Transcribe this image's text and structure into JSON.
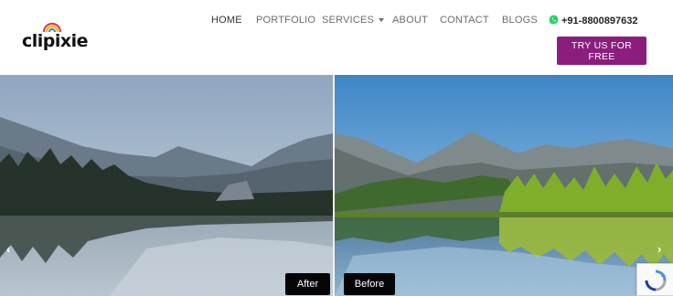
{
  "brand": {
    "logo_text": "clipixie"
  },
  "nav": {
    "items": [
      {
        "label": "HOME",
        "active": true
      },
      {
        "label": "PORTFOLIO"
      },
      {
        "label": "SERVICES",
        "has_dropdown": true
      },
      {
        "label": "ABOUT"
      },
      {
        "label": "CONTACT"
      },
      {
        "label": "BLOGS"
      }
    ],
    "phone": "+91-8800897632",
    "phone_icon": "whatsapp-icon"
  },
  "cta": {
    "label": "TRY US FOR FREE",
    "color": "#8b1d7c"
  },
  "hero": {
    "after_label": "After",
    "before_label": "Before",
    "prev_icon": "chevron-left-icon",
    "next_icon": "chevron-right-icon",
    "prev_glyph": "‹",
    "next_glyph": "›"
  },
  "recaptcha": {
    "icon": "recaptcha-icon"
  }
}
